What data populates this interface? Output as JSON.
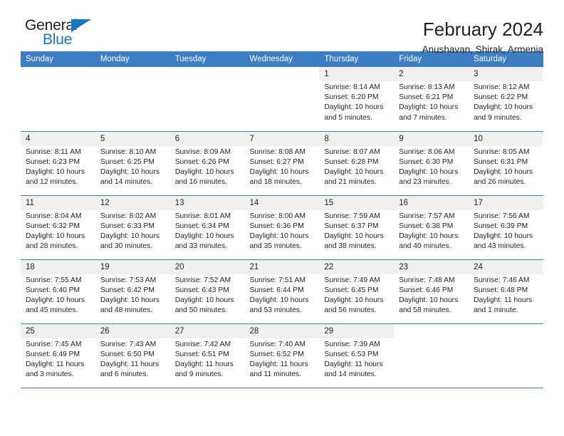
{
  "brand": {
    "name_part1": "General",
    "name_part2": "Blue",
    "triangle_color": "#1878be"
  },
  "header": {
    "title": "February 2024",
    "subtitle": "Anushavan, Shirak, Armenia"
  },
  "theme": {
    "header_blue": "#3c7dc4",
    "daynum_band": "#f0f0f0",
    "text": "#231f20"
  },
  "calendar": {
    "weekday_headers": [
      "Sunday",
      "Monday",
      "Tuesday",
      "Wednesday",
      "Thursday",
      "Friday",
      "Saturday"
    ],
    "weeks": [
      [
        {
          "day": "",
          "empty": true
        },
        {
          "day": "",
          "empty": true
        },
        {
          "day": "",
          "empty": true
        },
        {
          "day": "",
          "empty": true
        },
        {
          "day": "1",
          "sunrise": "Sunrise: 8:14 AM",
          "sunset": "Sunset: 6:20 PM",
          "daylight": "Daylight: 10 hours and 5 minutes."
        },
        {
          "day": "2",
          "sunrise": "Sunrise: 8:13 AM",
          "sunset": "Sunset: 6:21 PM",
          "daylight": "Daylight: 10 hours and 7 minutes."
        },
        {
          "day": "3",
          "sunrise": "Sunrise: 8:12 AM",
          "sunset": "Sunset: 6:22 PM",
          "daylight": "Daylight: 10 hours and 9 minutes."
        }
      ],
      [
        {
          "day": "4",
          "sunrise": "Sunrise: 8:11 AM",
          "sunset": "Sunset: 6:23 PM",
          "daylight": "Daylight: 10 hours and 12 minutes."
        },
        {
          "day": "5",
          "sunrise": "Sunrise: 8:10 AM",
          "sunset": "Sunset: 6:25 PM",
          "daylight": "Daylight: 10 hours and 14 minutes."
        },
        {
          "day": "6",
          "sunrise": "Sunrise: 8:09 AM",
          "sunset": "Sunset: 6:26 PM",
          "daylight": "Daylight: 10 hours and 16 minutes."
        },
        {
          "day": "7",
          "sunrise": "Sunrise: 8:08 AM",
          "sunset": "Sunset: 6:27 PM",
          "daylight": "Daylight: 10 hours and 18 minutes."
        },
        {
          "day": "8",
          "sunrise": "Sunrise: 8:07 AM",
          "sunset": "Sunset: 6:28 PM",
          "daylight": "Daylight: 10 hours and 21 minutes."
        },
        {
          "day": "9",
          "sunrise": "Sunrise: 8:06 AM",
          "sunset": "Sunset: 6:30 PM",
          "daylight": "Daylight: 10 hours and 23 minutes."
        },
        {
          "day": "10",
          "sunrise": "Sunrise: 8:05 AM",
          "sunset": "Sunset: 6:31 PM",
          "daylight": "Daylight: 10 hours and 26 minutes."
        }
      ],
      [
        {
          "day": "11",
          "sunrise": "Sunrise: 8:04 AM",
          "sunset": "Sunset: 6:32 PM",
          "daylight": "Daylight: 10 hours and 28 minutes."
        },
        {
          "day": "12",
          "sunrise": "Sunrise: 8:02 AM",
          "sunset": "Sunset: 6:33 PM",
          "daylight": "Daylight: 10 hours and 30 minutes."
        },
        {
          "day": "13",
          "sunrise": "Sunrise: 8:01 AM",
          "sunset": "Sunset: 6:34 PM",
          "daylight": "Daylight: 10 hours and 33 minutes."
        },
        {
          "day": "14",
          "sunrise": "Sunrise: 8:00 AM",
          "sunset": "Sunset: 6:36 PM",
          "daylight": "Daylight: 10 hours and 35 minutes."
        },
        {
          "day": "15",
          "sunrise": "Sunrise: 7:59 AM",
          "sunset": "Sunset: 6:37 PM",
          "daylight": "Daylight: 10 hours and 38 minutes."
        },
        {
          "day": "16",
          "sunrise": "Sunrise: 7:57 AM",
          "sunset": "Sunset: 6:38 PM",
          "daylight": "Daylight: 10 hours and 40 minutes."
        },
        {
          "day": "17",
          "sunrise": "Sunrise: 7:56 AM",
          "sunset": "Sunset: 6:39 PM",
          "daylight": "Daylight: 10 hours and 43 minutes."
        }
      ],
      [
        {
          "day": "18",
          "sunrise": "Sunrise: 7:55 AM",
          "sunset": "Sunset: 6:40 PM",
          "daylight": "Daylight: 10 hours and 45 minutes."
        },
        {
          "day": "19",
          "sunrise": "Sunrise: 7:53 AM",
          "sunset": "Sunset: 6:42 PM",
          "daylight": "Daylight: 10 hours and 48 minutes."
        },
        {
          "day": "20",
          "sunrise": "Sunrise: 7:52 AM",
          "sunset": "Sunset: 6:43 PM",
          "daylight": "Daylight: 10 hours and 50 minutes."
        },
        {
          "day": "21",
          "sunrise": "Sunrise: 7:51 AM",
          "sunset": "Sunset: 6:44 PM",
          "daylight": "Daylight: 10 hours and 53 minutes."
        },
        {
          "day": "22",
          "sunrise": "Sunrise: 7:49 AM",
          "sunset": "Sunset: 6:45 PM",
          "daylight": "Daylight: 10 hours and 56 minutes."
        },
        {
          "day": "23",
          "sunrise": "Sunrise: 7:48 AM",
          "sunset": "Sunset: 6:46 PM",
          "daylight": "Daylight: 10 hours and 58 minutes."
        },
        {
          "day": "24",
          "sunrise": "Sunrise: 7:46 AM",
          "sunset": "Sunset: 6:48 PM",
          "daylight": "Daylight: 11 hours and 1 minute."
        }
      ],
      [
        {
          "day": "25",
          "sunrise": "Sunrise: 7:45 AM",
          "sunset": "Sunset: 6:49 PM",
          "daylight": "Daylight: 11 hours and 3 minutes."
        },
        {
          "day": "26",
          "sunrise": "Sunrise: 7:43 AM",
          "sunset": "Sunset: 6:50 PM",
          "daylight": "Daylight: 11 hours and 6 minutes."
        },
        {
          "day": "27",
          "sunrise": "Sunrise: 7:42 AM",
          "sunset": "Sunset: 6:51 PM",
          "daylight": "Daylight: 11 hours and 9 minutes."
        },
        {
          "day": "28",
          "sunrise": "Sunrise: 7:40 AM",
          "sunset": "Sunset: 6:52 PM",
          "daylight": "Daylight: 11 hours and 11 minutes."
        },
        {
          "day": "29",
          "sunrise": "Sunrise: 7:39 AM",
          "sunset": "Sunset: 6:53 PM",
          "daylight": "Daylight: 11 hours and 14 minutes."
        },
        {
          "day": "",
          "empty": true
        },
        {
          "day": "",
          "empty": true
        }
      ]
    ]
  }
}
